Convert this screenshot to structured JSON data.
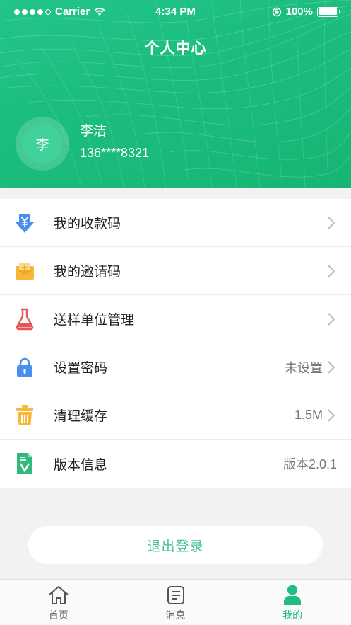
{
  "status_bar": {
    "carrier": "Carrier",
    "time": "4:34 PM",
    "battery": "100%"
  },
  "header": {
    "title": "个人中心",
    "avatar_text": "李",
    "user_name": "李洁",
    "user_phone": "136****8321"
  },
  "menu": [
    {
      "label": "我的收款码",
      "value": "",
      "icon": "payment-qr-icon"
    },
    {
      "label": "我的邀请码",
      "value": "",
      "icon": "invite-icon"
    },
    {
      "label": "送样单位管理",
      "value": "",
      "icon": "flask-icon"
    },
    {
      "label": "设置密码",
      "value": "未设置",
      "icon": "lock-icon"
    },
    {
      "label": "清理缓存",
      "value": "1.5M",
      "icon": "trash-icon"
    },
    {
      "label": "版本信息",
      "value": "版本2.0.1",
      "icon": "version-doc-icon"
    }
  ],
  "logout_label": "退出登录",
  "tabs": [
    {
      "label": "首页",
      "icon": "home-icon",
      "active": false
    },
    {
      "label": "消息",
      "icon": "message-icon",
      "active": false
    },
    {
      "label": "我的",
      "icon": "profile-icon",
      "active": true
    }
  ],
  "colors": {
    "brand_green": "#1bbd7e",
    "accent_text": "#4cc48f"
  }
}
